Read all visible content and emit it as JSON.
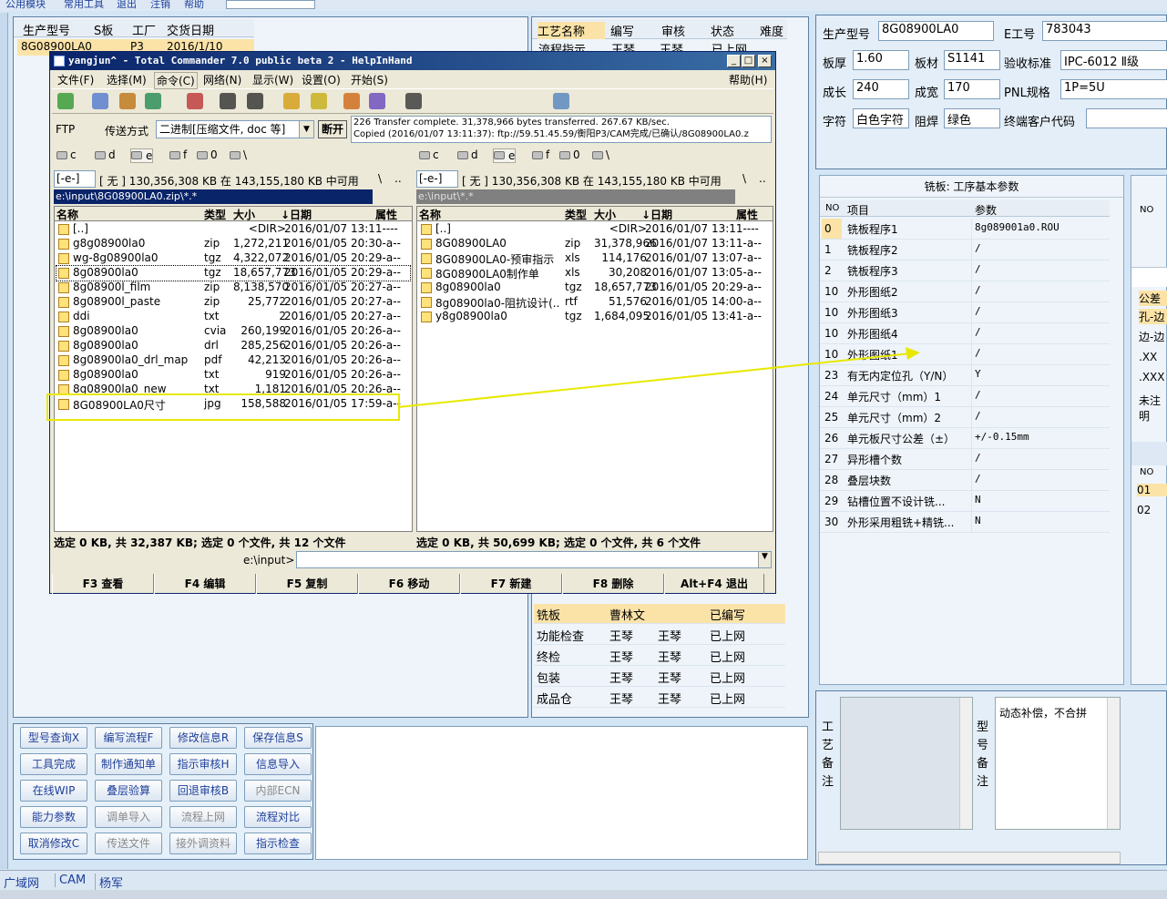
{
  "top_menu": [
    "公用模块",
    "常用工具",
    "退出",
    "注销",
    "帮助"
  ],
  "order_table": {
    "headers": [
      "生产型号",
      "S板",
      "工厂",
      "交货日期"
    ],
    "row": [
      "8G08900LA0",
      "",
      "P3",
      "2016/1/10"
    ]
  },
  "process_table": {
    "headers": [
      "工艺名称",
      "编写",
      "审核",
      "状态",
      "难度"
    ],
    "first_row": [
      "流程指示",
      "王琴",
      "王琴",
      "已上网"
    ],
    "rows": [
      {
        "name": "铣板",
        "writer": "曹林文",
        "reviewer": "",
        "status": "已编写"
      },
      {
        "name": "功能检查",
        "writer": "王琴",
        "reviewer": "王琴",
        "status": "已上网"
      },
      {
        "name": "终检",
        "writer": "王琴",
        "reviewer": "王琴",
        "status": "已上网"
      },
      {
        "name": "包装",
        "writer": "王琴",
        "reviewer": "王琴",
        "status": "已上网"
      },
      {
        "name": "成品仓",
        "writer": "王琴",
        "reviewer": "王琴",
        "status": "已上网"
      }
    ]
  },
  "info_panel": {
    "model_label": "生产型号",
    "model": "8G08900LA0",
    "e_label": "E工号",
    "e_value": "783043",
    "thick_label": "板厚",
    "thick": "1.60",
    "mat_label": "板材",
    "mat": "S1141",
    "std_label": "验收标准",
    "std": "IPC-6012 Ⅱ级",
    "len_label": "成长",
    "len": "240",
    "wid_label": "成宽",
    "wid": "170",
    "pnl_label": "PNL规格",
    "pnl": "1P=5U",
    "char_label": "字符",
    "char": "白色字符",
    "mask_label": "阻焊",
    "mask": "绿色",
    "cust_label": "终端客户代码",
    "cust": ""
  },
  "param_table": {
    "title": "铣板: 工序基本参数",
    "headers": [
      "NO",
      "项目",
      "参数"
    ],
    "rows": [
      [
        "0",
        "铣板程序1",
        "8g089001a0.ROU"
      ],
      [
        "1",
        "铣板程序2",
        "/"
      ],
      [
        "2",
        "铣板程序3",
        "/"
      ],
      [
        "10",
        "外形图纸2",
        "/"
      ],
      [
        "10",
        "外形图纸3",
        "/"
      ],
      [
        "10",
        "外形图纸4",
        "/"
      ],
      [
        "10",
        "外形图纸1",
        "/"
      ],
      [
        "23",
        "有无内定位孔（Y/N）",
        "Y"
      ],
      [
        "24",
        "单元尺寸（mm）1",
        "/"
      ],
      [
        "25",
        "单元尺寸（mm）2",
        "/"
      ],
      [
        "26",
        "单元板尺寸公差（±）",
        "+/-0.15mm"
      ],
      [
        "27",
        "异形槽个数",
        "/"
      ],
      [
        "28",
        "叠层块数",
        "/"
      ],
      [
        "29",
        "钻槽位置不设计铣...",
        "N"
      ],
      [
        "30",
        "外形采用粗铣+精铣...",
        "N"
      ]
    ]
  },
  "right_strip": {
    "no": "NO",
    "tol": "公差",
    "hole_edge": "孔-边",
    "edge_edge": "边-边",
    "xx": ".XX",
    "xxx": ".XXX",
    "unmarked": "未注明",
    "no2": "NO",
    "r1": "01",
    "r2": "02"
  },
  "notes": {
    "process_label": "工艺备注",
    "model_label": "型号备注",
    "model_note": "动态补偿，不合拼"
  },
  "buttons": [
    [
      "型号查询X",
      "编写流程F",
      "修改信息R",
      "保存信息S"
    ],
    [
      "工具完成",
      "制作通知单",
      "指示审核H",
      "信息导入"
    ],
    [
      "在线WIP",
      "叠层验算",
      "回退审核B",
      "内部ECN"
    ],
    [
      "能力参数",
      "调单导入",
      "流程上网",
      "流程对比"
    ],
    [
      "取消修改C",
      "传送文件",
      "接外调资料",
      "指示检查"
    ]
  ],
  "disabled_buttons": [
    "内部ECN",
    "调单导入",
    "流程上网",
    "传送文件",
    "接外调资料"
  ],
  "status_bar": [
    "广域网",
    "CAM",
    "杨军"
  ],
  "tc": {
    "title": "yangjun^ - Total Commander 7.0 public beta 2 - HelpInHand",
    "menu": [
      "文件(F)",
      "选择(M)",
      "命令(C)",
      "网络(N)",
      "显示(W)",
      "设置(O)",
      "开始(S)"
    ],
    "help": "帮助(H)",
    "ftp_label": "FTP",
    "mode_label": "传送方式",
    "mode_value": "二进制[压缩文件, doc 等]",
    "disconnect": "断开",
    "log1": "226 Transfer complete. 31,378,966 bytes transferred. 267.67 KB/sec.",
    "log2": "Copied (2016/01/07 13:11:37): ftp://59.51.45.59/衡阳P3/CAM完成/已确认/8G08900LA0.z",
    "drives": [
      "c",
      "d",
      "e",
      "f",
      "0",
      "\\"
    ],
    "left": {
      "drive": "[-e-]",
      "info": "[ 无 ]  130,356,308 KB 在 143,155,180 KB 中可用",
      "path": "e:\\input\\8G08900LA0.zip\\*.*",
      "headers": [
        "名称",
        "类型",
        "大小",
        "↓日期",
        "属性"
      ],
      "files": [
        [
          "[..]",
          "",
          "<DIR>",
          "2016/01/07 13:11----"
        ],
        [
          "g8g08900la0",
          "zip",
          "1,272,211",
          "2016/01/05 20:30-a--"
        ],
        [
          "wg-8g08900la0",
          "tgz",
          "4,322,072",
          "2016/01/05 20:29-a--"
        ],
        [
          "8g08900la0",
          "tgz",
          "18,657,773",
          "2016/01/05 20:29-a--"
        ],
        [
          "8g08900l_film",
          "zip",
          "8,138,570",
          "2016/01/05 20:27-a--"
        ],
        [
          "8g08900l_paste",
          "zip",
          "25,772",
          "2016/01/05 20:27-a--"
        ],
        [
          "ddi",
          "txt",
          "2",
          "2016/01/05 20:27-a--"
        ],
        [
          "8g08900la0",
          "cvia",
          "260,199",
          "2016/01/05 20:26-a--"
        ],
        [
          "8g08900la0",
          "drl",
          "285,256",
          "2016/01/05 20:26-a--"
        ],
        [
          "8g08900la0_drl_map",
          "pdf",
          "42,213",
          "2016/01/05 20:26-a--"
        ],
        [
          "8g08900la0",
          "txt",
          "919",
          "2016/01/05 20:26-a--"
        ],
        [
          "8g08900la0_new",
          "txt",
          "1,181",
          "2016/01/05 20:26-a--"
        ],
        [
          "8G08900LA0尺寸",
          "jpg",
          "158,588",
          "2016/01/05 17:59-a--"
        ]
      ],
      "status": "选定 0 KB, 共 32,387 KB; 选定 0 个文件, 共 12 个文件"
    },
    "right": {
      "drive": "[-e-]",
      "info": "[ 无 ]  130,356,308 KB 在 143,155,180 KB 中可用",
      "path": "e:\\input\\*.*",
      "headers": [
        "名称",
        "类型",
        "大小",
        "↓日期",
        "属性"
      ],
      "files": [
        [
          "[..]",
          "",
          "<DIR>",
          "2016/01/07 13:11----"
        ],
        [
          "8G08900LA0",
          "zip",
          "31,378,966",
          "2016/01/07 13:11-a--"
        ],
        [
          "8G08900LA0-预审指示",
          "xls",
          "114,176",
          "2016/01/07 13:07-a--"
        ],
        [
          "8G08900LA0制作单",
          "xls",
          "30,208",
          "2016/01/07 13:05-a--"
        ],
        [
          "8g08900la0",
          "tgz",
          "18,657,773",
          "2016/01/05 20:29-a--"
        ],
        [
          "8g08900la0-阻抗设计(..",
          "rtf",
          "51,576",
          "2016/01/05 14:00-a--"
        ],
        [
          "y8g08900la0",
          "tgz",
          "1,684,095",
          "2016/01/05 13:41-a--"
        ]
      ],
      "status": "选定 0 KB, 共 50,699 KB; 选定 0 个文件, 共 6 个文件"
    },
    "cmd_label": "e:\\input>",
    "fkeys": [
      "F3 查看",
      "F4 编辑",
      "F5 复制",
      "F6 移动",
      "F7 新建",
      "F8 删除",
      "Alt+F4 退出"
    ]
  },
  "colors": {
    "accent": "#fbe3a8",
    "highlight": "#ffff00",
    "title_bar": "#0a246a"
  }
}
